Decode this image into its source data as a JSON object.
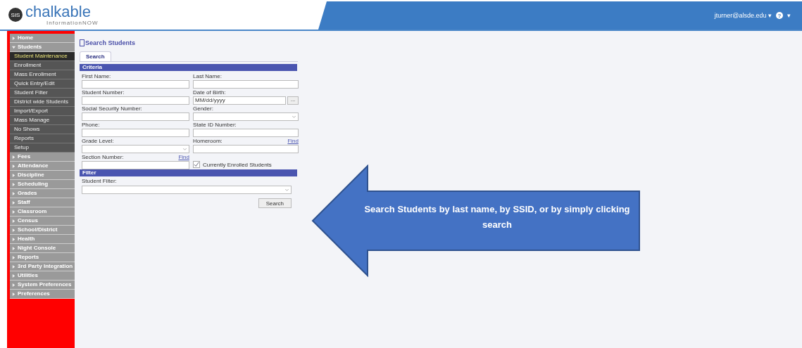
{
  "header": {
    "logo": "chalkable",
    "logo_badge": "SIS",
    "logo_sub": "InformationNOW",
    "user": "jturner@alsde.edu",
    "user_caret": "▾",
    "help": "?",
    "help_caret": "▾"
  },
  "sidebar": {
    "items": [
      {
        "label": "Home",
        "expanded": false
      },
      {
        "label": "Students",
        "expanded": true,
        "children": [
          {
            "label": "Student Maintenance",
            "selected": true
          },
          {
            "label": "Enrollment",
            "selected": false
          },
          {
            "label": "Mass Enrollment",
            "selected": false
          },
          {
            "label": "Quick Entry/Edit",
            "selected": false
          },
          {
            "label": "Student Filter",
            "selected": false
          },
          {
            "label": "District wide Students",
            "selected": false
          },
          {
            "label": "Import/Export",
            "selected": false
          },
          {
            "label": "Mass Manage",
            "selected": false
          },
          {
            "label": "No Shows",
            "selected": false
          },
          {
            "label": "Reports",
            "selected": false
          },
          {
            "label": "Setup",
            "selected": false
          }
        ]
      },
      {
        "label": "Fees",
        "expanded": false
      },
      {
        "label": "Attendance",
        "expanded": false
      },
      {
        "label": "Discipline",
        "expanded": false
      },
      {
        "label": "Scheduling",
        "expanded": false
      },
      {
        "label": "Grades",
        "expanded": false
      },
      {
        "label": "Staff",
        "expanded": false
      },
      {
        "label": "Classroom",
        "expanded": false
      },
      {
        "label": "Census",
        "expanded": false
      },
      {
        "label": "School/District",
        "expanded": false
      },
      {
        "label": "Health",
        "expanded": false
      },
      {
        "label": "Night Console",
        "expanded": false
      },
      {
        "label": "Reports",
        "expanded": false
      },
      {
        "label": "3rd Party Integration",
        "expanded": false
      },
      {
        "label": "Utilities",
        "expanded": false
      },
      {
        "label": "System Preferences",
        "expanded": false
      },
      {
        "label": "Preferences",
        "expanded": false
      }
    ]
  },
  "page_title": "Search Students",
  "tabs": [
    {
      "label": "Search",
      "selected": true
    }
  ],
  "criteria": {
    "title": "Criteria",
    "fields": [
      {
        "label": "First Name:",
        "kind": "text"
      },
      {
        "label": "Last Name:",
        "kind": "text"
      },
      {
        "label": "Student Number:",
        "kind": "text"
      },
      {
        "label": "Date of Birth:",
        "kind": "date",
        "value": "MM/dd/yyyy",
        "button": "..."
      },
      {
        "label": "Social Security Number:",
        "kind": "text"
      },
      {
        "label": "Gender:",
        "kind": "select"
      },
      {
        "label": "Phone:",
        "kind": "text"
      },
      {
        "label": "State ID Number:",
        "kind": "text"
      },
      {
        "label": "Grade Level:",
        "kind": "select"
      },
      {
        "label": "Homeroom:",
        "kind": "text",
        "link": "Find"
      },
      {
        "label": "Section Number:",
        "kind": "text",
        "link": "Find"
      },
      {
        "label": "Currently Enrolled Students",
        "kind": "checkbox",
        "checked": true
      }
    ]
  },
  "filter": {
    "title": "Filter",
    "label": "Student Filter:"
  },
  "search_button": "Search",
  "callout": "Search Students by last name, by SSID, or by simply clicking search"
}
